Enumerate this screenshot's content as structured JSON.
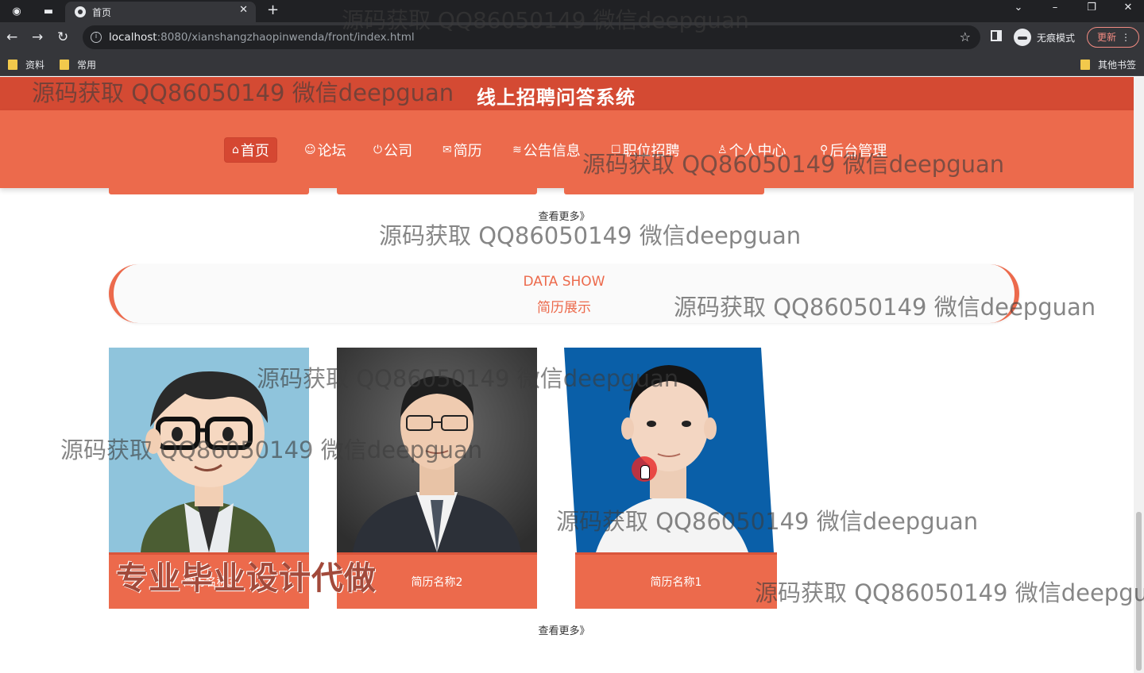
{
  "browser": {
    "tab_title": "首页",
    "url_host": "localhost",
    "url_rest": ":8080/xianshangzhaopinwenda/front/index.html",
    "incognito_label": "无痕模式",
    "update_label": "更新",
    "bookmarks": [
      "资料",
      "常用"
    ],
    "other_bookmarks": "其他书签"
  },
  "site": {
    "title": "线上招聘问答系统"
  },
  "menu": [
    {
      "icon": "⌂",
      "label": "首页"
    },
    {
      "icon": "☺",
      "label": "论坛"
    },
    {
      "icon": "⏻",
      "label": "公司"
    },
    {
      "icon": "✉",
      "label": "简历"
    },
    {
      "icon": "≋",
      "label": "公告信息"
    },
    {
      "icon": "☐",
      "label": "职位招聘"
    },
    {
      "icon": "♙",
      "label": "个人中心"
    },
    {
      "icon": "⚲",
      "label": "后台管理"
    }
  ],
  "section_prev": {
    "more_label": "查看更多》"
  },
  "data_show": {
    "title_en": "DATA SHOW",
    "title_zh": "简历展示",
    "cards": [
      {
        "name": "简历名称3"
      },
      {
        "name": "简历名称2"
      },
      {
        "name": "简历名称1"
      }
    ],
    "more_label": "查看更多》"
  },
  "watermark": {
    "text": "源码获取 QQ86050149 微信deepguan",
    "overlay": "专业毕业设计代做"
  },
  "colors": {
    "header_dark": "#d44a33",
    "header": "#ec6a4c",
    "accent": "#ec6a4c"
  }
}
